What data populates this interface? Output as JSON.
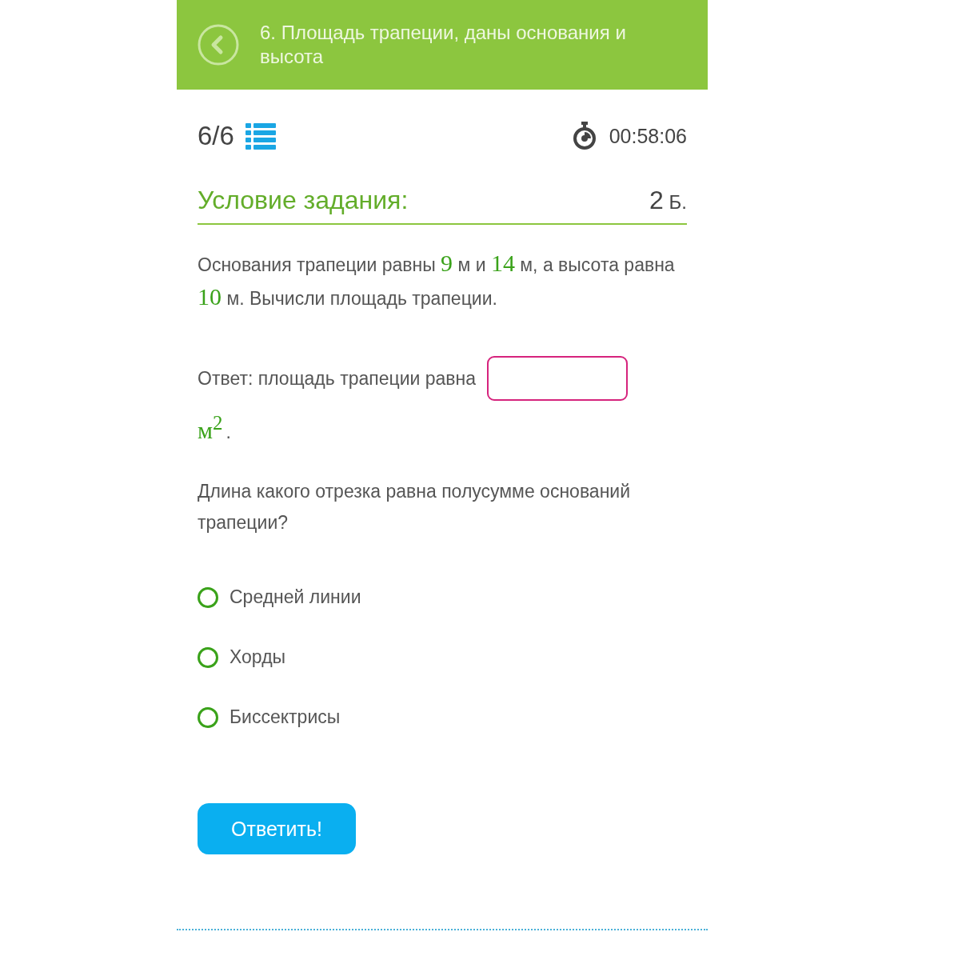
{
  "header": {
    "title": "6. Площадь трапеции, даны основания и высота"
  },
  "progress": {
    "counter": "6/6",
    "timer": "00:58:06"
  },
  "task": {
    "heading": "Условие задания:",
    "points": "2",
    "points_unit": "Б."
  },
  "condition": [
    {
      "kind": "text",
      "text": "Основания трапеции равны "
    },
    {
      "kind": "number",
      "text": "9"
    },
    {
      "kind": "text",
      "text": " м и "
    },
    {
      "kind": "number",
      "text": "14"
    },
    {
      "kind": "text",
      "text": " м, а высота равна "
    },
    {
      "kind": "number",
      "text": "10"
    },
    {
      "kind": "text",
      "text": " м. Вычисли площадь трапеции."
    }
  ],
  "answer": {
    "label": "Ответ: площадь трапеции равна",
    "unit": "м$^{2}$",
    "end": "."
  },
  "question": "Длина какого отрезка равна полусумме оснований трапеции?",
  "options": [
    {
      "label": "Средней линии",
      "selected": false
    },
    {
      "label": "Хорды",
      "selected": false
    },
    {
      "label": "Биссектрисы",
      "selected": false
    }
  ],
  "submit": "Ответить!"
}
